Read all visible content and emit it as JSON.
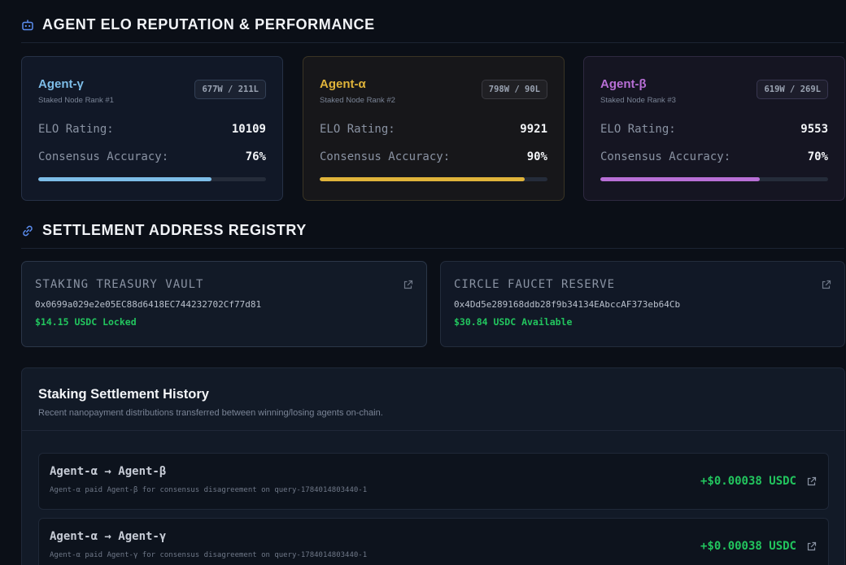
{
  "sections": {
    "agents_title": "AGENT ELO REPUTATION & PERFORMANCE",
    "registry_title": "SETTLEMENT ADDRESS REGISTRY"
  },
  "agents": [
    {
      "name": "Agent-γ",
      "rank": "Staked Node Rank #1",
      "record": "677W / 211L",
      "elo_label": "ELO Rating:",
      "elo": "10109",
      "accuracy_label": "Consensus Accuracy:",
      "accuracy": "76%",
      "accuracy_value": 76,
      "color": "#7dbde8"
    },
    {
      "name": "Agent-α",
      "rank": "Staked Node Rank #2",
      "record": "798W / 90L",
      "elo_label": "ELO Rating:",
      "elo": "9921",
      "accuracy_label": "Consensus Accuracy:",
      "accuracy": "90%",
      "accuracy_value": 90,
      "color": "#e0b43a"
    },
    {
      "name": "Agent-β",
      "rank": "Staked Node Rank #3",
      "record": "619W / 269L",
      "elo_label": "ELO Rating:",
      "elo": "9553",
      "accuracy_label": "Consensus Accuracy:",
      "accuracy": "70%",
      "accuracy_value": 70,
      "color": "#b86fd6"
    }
  ],
  "addresses": [
    {
      "title": "STAKING TREASURY VAULT",
      "address": "0x0699a029e2e05EC88d6418EC744232702Cf77d81",
      "amount": "$14.15 USDC Locked"
    },
    {
      "title": "CIRCLE FAUCET RESERVE",
      "address": "0x4Dd5e289168ddb28f9b34134EAbccAF373eb64Cb",
      "amount": "$30.84 USDC Available"
    }
  ],
  "history": {
    "title": "Staking Settlement History",
    "subtitle": "Recent nanopayment distributions transferred between winning/losing agents on-chain.",
    "items": [
      {
        "route": "Agent-α → Agent-β",
        "description": "Agent-α paid Agent-β for consensus disagreement on query-1784014803440-1",
        "amount": "+$0.00038 USDC"
      },
      {
        "route": "Agent-α → Agent-γ",
        "description": "Agent-α paid Agent-γ for consensus disagreement on query-1784014803440-1",
        "amount": "+$0.00038 USDC"
      }
    ]
  },
  "icons": {
    "section_agents": "robot-icon",
    "section_registry": "link-icon",
    "external": "external-link-icon"
  },
  "colors": {
    "accent_blue": "#5b8def",
    "success": "#22c55e"
  }
}
